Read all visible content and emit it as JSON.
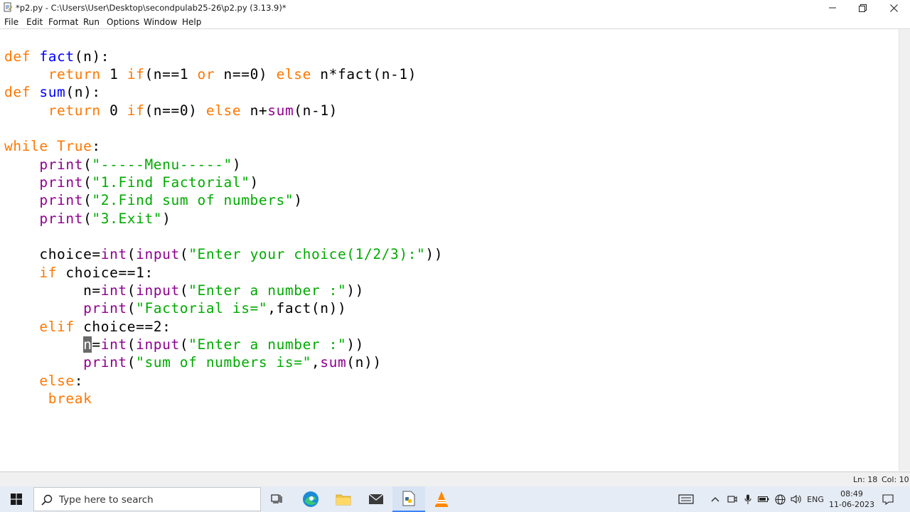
{
  "window": {
    "title": "*p2.py - C:\\Users\\User\\Desktop\\secondpulab25-26\\p2.py (3.13.9)*",
    "minimize_icon": "minimize-icon",
    "restore_icon": "restore-icon",
    "close_icon": "close-icon"
  },
  "menu": {
    "items": [
      "File",
      "Edit",
      "Format",
      "Run",
      "Options",
      "Window",
      "Help"
    ]
  },
  "code": {
    "lines": [
      {
        "indent": "",
        "parts": [
          {
            "t": "def",
            "c": "kw"
          },
          {
            "t": " "
          },
          {
            "t": "fact",
            "c": "def"
          },
          {
            "t": "(n):"
          }
        ]
      },
      {
        "indent": "     ",
        "parts": [
          {
            "t": "return",
            "c": "kw"
          },
          {
            "t": " 1 "
          },
          {
            "t": "if",
            "c": "kw"
          },
          {
            "t": "(n==1 "
          },
          {
            "t": "or",
            "c": "kw"
          },
          {
            "t": " n==0) "
          },
          {
            "t": "else",
            "c": "kw"
          },
          {
            "t": " n*fact(n-1)"
          }
        ]
      },
      {
        "indent": "",
        "parts": [
          {
            "t": "def",
            "c": "kw"
          },
          {
            "t": " "
          },
          {
            "t": "sum",
            "c": "def"
          },
          {
            "t": "(n):"
          }
        ]
      },
      {
        "indent": "     ",
        "parts": [
          {
            "t": "return",
            "c": "kw"
          },
          {
            "t": " 0 "
          },
          {
            "t": "if",
            "c": "kw"
          },
          {
            "t": "(n==0) "
          },
          {
            "t": "else",
            "c": "kw"
          },
          {
            "t": " n+"
          },
          {
            "t": "sum",
            "c": "bi"
          },
          {
            "t": "(n-1)"
          }
        ]
      },
      {
        "indent": "",
        "parts": []
      },
      {
        "indent": "",
        "parts": [
          {
            "t": "while",
            "c": "kw"
          },
          {
            "t": " "
          },
          {
            "t": "True",
            "c": "kw"
          },
          {
            "t": ":"
          }
        ]
      },
      {
        "indent": "    ",
        "parts": [
          {
            "t": "print",
            "c": "bi"
          },
          {
            "t": "("
          },
          {
            "t": "\"-----Menu-----\"",
            "c": "str"
          },
          {
            "t": ")"
          }
        ]
      },
      {
        "indent": "    ",
        "parts": [
          {
            "t": "print",
            "c": "bi"
          },
          {
            "t": "("
          },
          {
            "t": "\"1.Find Factorial\"",
            "c": "str"
          },
          {
            "t": ")"
          }
        ]
      },
      {
        "indent": "    ",
        "parts": [
          {
            "t": "print",
            "c": "bi"
          },
          {
            "t": "("
          },
          {
            "t": "\"2.Find sum of numbers\"",
            "c": "str"
          },
          {
            "t": ")"
          }
        ]
      },
      {
        "indent": "    ",
        "parts": [
          {
            "t": "print",
            "c": "bi"
          },
          {
            "t": "("
          },
          {
            "t": "\"3.Exit\"",
            "c": "str"
          },
          {
            "t": ")"
          }
        ]
      },
      {
        "indent": "",
        "parts": []
      },
      {
        "indent": "    ",
        "parts": [
          {
            "t": "choice="
          },
          {
            "t": "int",
            "c": "bi"
          },
          {
            "t": "("
          },
          {
            "t": "input",
            "c": "bi"
          },
          {
            "t": "("
          },
          {
            "t": "\"Enter your choice(1/2/3):\"",
            "c": "str"
          },
          {
            "t": "))"
          }
        ]
      },
      {
        "indent": "    ",
        "parts": [
          {
            "t": "if",
            "c": "kw"
          },
          {
            "t": " choice==1:"
          }
        ]
      },
      {
        "indent": "         ",
        "parts": [
          {
            "t": "n="
          },
          {
            "t": "int",
            "c": "bi"
          },
          {
            "t": "("
          },
          {
            "t": "input",
            "c": "bi"
          },
          {
            "t": "("
          },
          {
            "t": "\"Enter a number :\"",
            "c": "str"
          },
          {
            "t": "))"
          }
        ]
      },
      {
        "indent": "         ",
        "parts": [
          {
            "t": "print",
            "c": "bi"
          },
          {
            "t": "("
          },
          {
            "t": "\"Factorial is=\"",
            "c": "str"
          },
          {
            "t": ",fact(n))"
          }
        ]
      },
      {
        "indent": "    ",
        "parts": [
          {
            "t": "elif",
            "c": "kw"
          },
          {
            "t": " choice==2:"
          }
        ]
      },
      {
        "indent": "         ",
        "parts": [
          {
            "t": "n",
            "c": "cursor"
          },
          {
            "t": "="
          },
          {
            "t": "int",
            "c": "bi"
          },
          {
            "t": "("
          },
          {
            "t": "input",
            "c": "bi"
          },
          {
            "t": "("
          },
          {
            "t": "\"Enter a number :\"",
            "c": "str"
          },
          {
            "t": "))"
          }
        ]
      },
      {
        "indent": "         ",
        "parts": [
          {
            "t": "print",
            "c": "bi"
          },
          {
            "t": "("
          },
          {
            "t": "\"sum of numbers is=\"",
            "c": "str"
          },
          {
            "t": ","
          },
          {
            "t": "sum",
            "c": "bi"
          },
          {
            "t": "(n))"
          }
        ]
      },
      {
        "indent": "    ",
        "parts": [
          {
            "t": "else",
            "c": "kw"
          },
          {
            "t": ":"
          }
        ]
      },
      {
        "indent": "     ",
        "parts": [
          {
            "t": "break",
            "c": "kw"
          }
        ]
      }
    ]
  },
  "status": {
    "line": "Ln: 18",
    "col": "Col: 10"
  },
  "taskbar": {
    "search_placeholder": "Type here to search",
    "language": "ENG",
    "time": "08:49",
    "date": "11-06-2023"
  },
  "colors": {
    "keyword": "#ff7700",
    "definition": "#0000ff",
    "builtin": "#900090",
    "string": "#00aa00",
    "taskbar_bg": "#e6ecf5"
  }
}
